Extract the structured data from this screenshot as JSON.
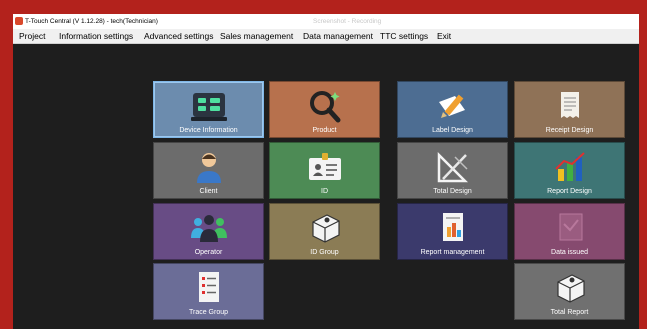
{
  "window": {
    "title": "T-Touch Central (V 1.12.28) -  tech(Technician)",
    "ghost_title": "Screenshot - Recording"
  },
  "menu": [
    {
      "label": "Project"
    },
    {
      "label": "Information settings"
    },
    {
      "label": "Advanced settings"
    },
    {
      "label": "Sales management"
    },
    {
      "label": "Data management"
    },
    {
      "label": "TTC settings"
    },
    {
      "label": "Exit"
    }
  ],
  "tiles": [
    {
      "label": "Device Information",
      "color": "#6c8cae",
      "icon": "device-icon"
    },
    {
      "label": "Product",
      "color": "#b7714d",
      "icon": "magnifier-icon"
    },
    {
      "label": "Label Design",
      "color": "#4d6d92",
      "icon": "label-pencil-icon"
    },
    {
      "label": "Receipt Design",
      "color": "#8f7257",
      "icon": "receipt-icon"
    },
    {
      "label": "Client",
      "color": "#6c6c6c",
      "icon": "person-icon"
    },
    {
      "label": "ID",
      "color": "#4d8b55",
      "icon": "id-card-icon"
    },
    {
      "label": "Total Design",
      "color": "#6c6c6c",
      "icon": "drafting-tools-icon"
    },
    {
      "label": "Report Design",
      "color": "#3e7575",
      "icon": "bar-chart-icon"
    },
    {
      "label": "Operator",
      "color": "#684c85",
      "icon": "group-icon"
    },
    {
      "label": "ID Group",
      "color": "#8b7c55",
      "icon": "box-icon"
    },
    {
      "label": "Report management",
      "color": "#3b3a6c",
      "icon": "report-icon"
    },
    {
      "label": "Data issued",
      "color": "#864a6f",
      "icon": "data-issued-icon"
    },
    {
      "label": "Trace Group",
      "color": "#6b6d97",
      "icon": "checklist-icon"
    },
    {
      "label": "Total Report",
      "color": "#707070",
      "icon": "box-total-icon"
    }
  ]
}
